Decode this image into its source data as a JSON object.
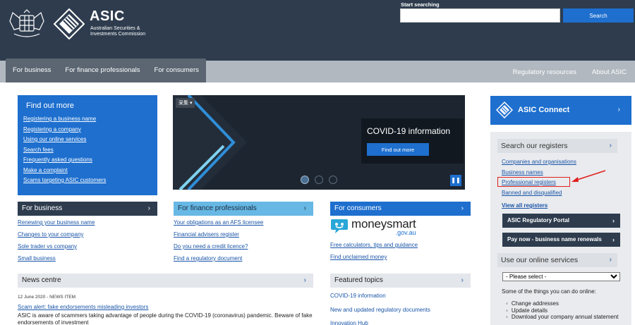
{
  "header": {
    "logo_title": "ASIC",
    "logo_subtitle": "Australian Securities & Investments Commission",
    "search_label": "Start searching",
    "search_value": "",
    "search_button": "Search"
  },
  "nav": {
    "left": [
      "For business",
      "For finance professionals",
      "For consumers"
    ],
    "right": [
      "Regulatory resources",
      "About ASIC"
    ]
  },
  "find_out_more": {
    "title": "Find out more",
    "links": [
      "Registering a business name",
      "Registering a company",
      "Using our online services",
      "Search fees",
      "Frequently asked questions",
      "Make a complaint",
      "Scams targeting ASIC customers"
    ]
  },
  "carousel": {
    "chip": "采集",
    "title": "COVID-19 information",
    "button": "Find out more",
    "slides": 3,
    "active_slide": 1
  },
  "for_business": {
    "title": "For business",
    "links": [
      "Renewing your business name",
      "Changes to your company",
      "Sole trader vs company",
      "Small business"
    ]
  },
  "for_finance": {
    "title": "For finance professionals",
    "links": [
      "Your obligations as an AFS licensee",
      "Financial advisers register",
      "Do you need a credit licence?",
      "Find a regulatory document"
    ]
  },
  "for_consumers": {
    "title": "For consumers",
    "moneysmart_name": "moneysmart",
    "moneysmart_domain": ".gov.au",
    "links": [
      "Free calculators, tips and guidance",
      "Find unclaimed money"
    ]
  },
  "news": {
    "title": "News centre",
    "meta": "12 June 2020 - NEWS ITEM",
    "headline": "Scam alert: fake endorsements misleading investors",
    "body": "ASIC is aware of scammers taking advantage of people during the COVID-19 (coronavirus) pandemic. Beware of fake endorsements of investment"
  },
  "featured": {
    "title": "Featured topics",
    "links": [
      "COVID-19 information",
      "New and updated regulatory documents",
      "Innovation Hub"
    ]
  },
  "sidebar": {
    "connect_label": "ASIC Connect",
    "registers_title": "Search our registers",
    "register_links": [
      "Companies and organisations",
      "Business names",
      "Professional registers",
      "Banned and disqualified"
    ],
    "view_all": "View all registers",
    "portal_button": "ASIC Regulatory Portal",
    "pay_button": "Pay now - business name renewals",
    "services_title": "Use our online services",
    "services_select": "- Please select -",
    "services_intro": "Some of the things you can do online:",
    "services_items": [
      "Change addresses",
      "Update details",
      "Download your company annual statement"
    ]
  },
  "colors": {
    "header_bg": "#2e3c4e",
    "accent_blue": "#1e6fce",
    "light_blue": "#67b8e4",
    "highlight_red": "#e0201d"
  }
}
